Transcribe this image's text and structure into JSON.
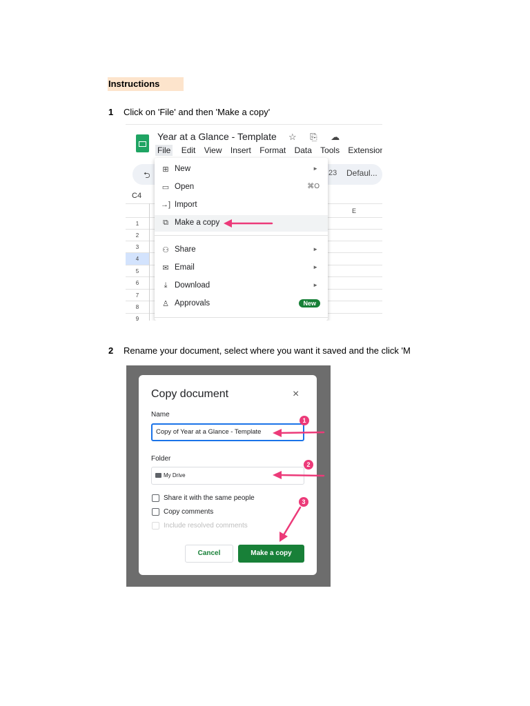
{
  "heading": "Instructions",
  "steps": [
    {
      "number": "1",
      "text": "Click on 'File' and then 'Make a copy'"
    },
    {
      "number": "2",
      "text": "Rename your document, select where you want it saved and the click 'M"
    }
  ],
  "screenshot1": {
    "doc_title": "Year at a Glance - Template",
    "title_icons": "☆ ⎘ ☁",
    "menubar": [
      "File",
      "Edit",
      "View",
      "Insert",
      "Format",
      "Data",
      "Tools",
      "Extensions"
    ],
    "toolbar_number": "23",
    "toolbar_font": "Defaul...",
    "cell_ref": "C4",
    "column_header": "E",
    "row_numbers": [
      "1",
      "2",
      "3",
      "4",
      "5",
      "6",
      "7",
      "8",
      "9"
    ],
    "menu_items": {
      "new": {
        "label": "New",
        "icon": "plus-square-icon"
      },
      "open": {
        "label": "Open",
        "shortcut": "⌘O",
        "icon": "folder-icon"
      },
      "import": {
        "label": "Import",
        "icon": "import-icon"
      },
      "make_copy": {
        "label": "Make a copy",
        "icon": "copy-icon"
      },
      "share": {
        "label": "Share",
        "icon": "person-add-icon"
      },
      "email": {
        "label": "Email",
        "icon": "mail-icon"
      },
      "download": {
        "label": "Download",
        "icon": "download-icon"
      },
      "approvals": {
        "label": "Approvals",
        "badge": "New",
        "icon": "approvals-icon"
      }
    },
    "arrow_color": "#ec3a79"
  },
  "screenshot2": {
    "dialog_title": "Copy document",
    "close": "×",
    "name_label": "Name",
    "name_value": "Copy of Year at a Glance - Template",
    "folder_label": "Folder",
    "folder_value": "My Drive",
    "checkboxes": [
      {
        "label": "Share it with the same people",
        "enabled": true,
        "checked": false
      },
      {
        "label": "Copy comments",
        "enabled": true,
        "checked": false
      },
      {
        "label": "Include resolved comments",
        "enabled": false,
        "checked": false
      }
    ],
    "cancel_label": "Cancel",
    "confirm_label": "Make a copy",
    "callouts": [
      "1",
      "2",
      "3"
    ],
    "accent_green": "#188038",
    "callout_color": "#ec3a79"
  }
}
